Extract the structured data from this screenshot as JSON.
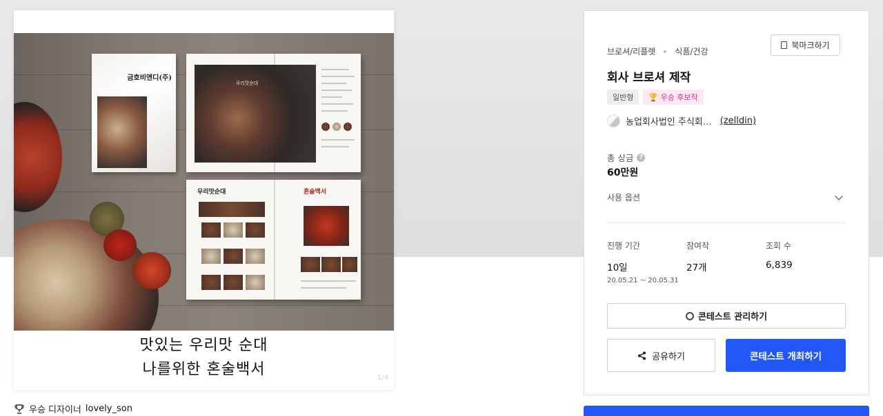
{
  "image": {
    "cover_title": "금호비앤디(주)",
    "spread_brand": "우리맛순대",
    "spread_logo": "혼술백서",
    "caption_line1": "맛있는 우리맛 순대",
    "caption_line2": "나를위한 혼술백서",
    "watermark": "1/4"
  },
  "winner": {
    "label": "우승 디자이너",
    "name": "lovely_son"
  },
  "panel": {
    "breadcrumb": [
      "브로셔/리플렛",
      "식품/건강"
    ],
    "bookmark_label": "북마크하기",
    "title": "회사 브로셔 제작",
    "badges": {
      "type": "일반형",
      "award": "🏆 우승 후보작"
    },
    "client": {
      "name": "농업회사법인 주식회…",
      "handle": "(zelldin)"
    },
    "prize": {
      "label": "총 상금",
      "value": "60만원"
    },
    "options_label": "사용 옵션",
    "stats": {
      "period_label": "진행 기간",
      "period_value": "10일",
      "period_range": "20.05.21 ~ 20.05.31",
      "entries_label": "참여작",
      "entries_value": "27개",
      "views_label": "조회 수",
      "views_value": "6,839"
    },
    "manage_label": "콘테스트 관리하기",
    "share_label": "공유하기",
    "host_label": "콘테스트 개최하기"
  },
  "colors": {
    "primary": "#2356f6",
    "award_pink": "#d6338c",
    "award_bg": "#fbe8f3"
  }
}
